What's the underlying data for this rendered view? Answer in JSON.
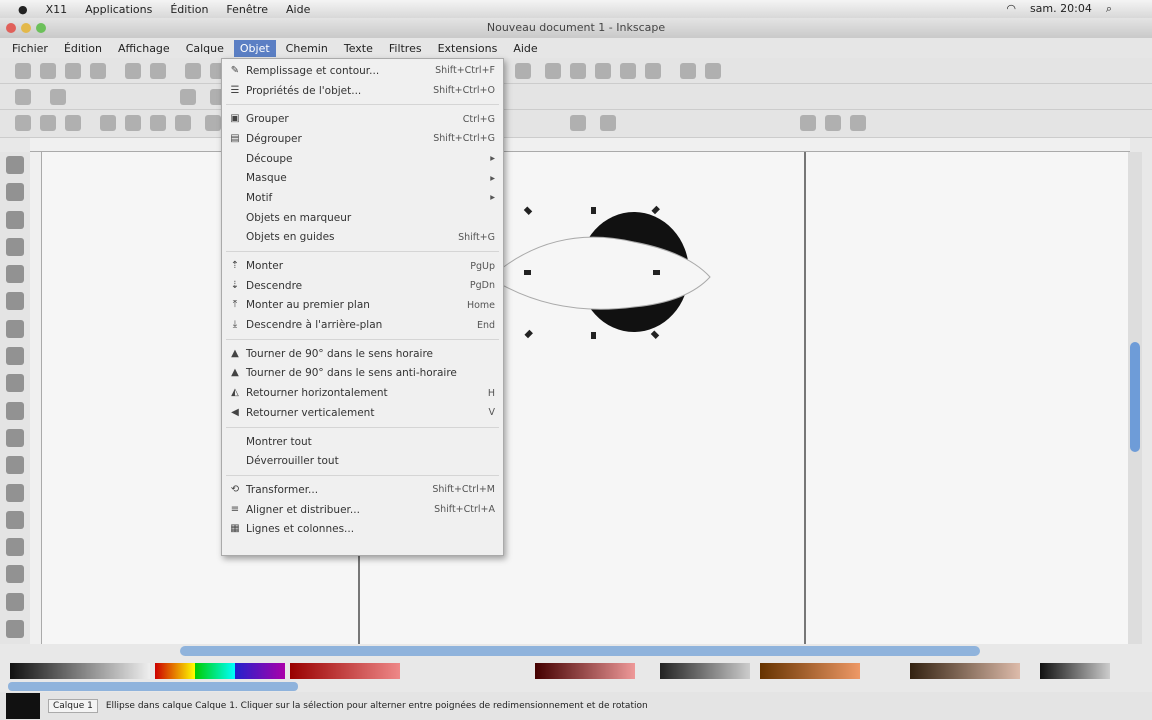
{
  "mac_menubar": {
    "items": [
      "X11",
      "Applications",
      "Édition",
      "Fenêtre",
      "Aide"
    ],
    "clock": "sam. 20:04"
  },
  "window": {
    "title": "Nouveau document 1 - Inkscape"
  },
  "menubar": {
    "items": [
      "Fichier",
      "Édition",
      "Affichage",
      "Calque",
      "Objet",
      "Chemin",
      "Texte",
      "Filtres",
      "Extensions",
      "Aide"
    ],
    "active_index": 4
  },
  "object_menu": {
    "groups": [
      [
        {
          "label": "Remplissage et contour...",
          "shortcut": "Shift+Ctrl+F",
          "icon": "✎"
        },
        {
          "label": "Propriétés de l'objet...",
          "shortcut": "Shift+Ctrl+O",
          "icon": "☰"
        }
      ],
      [
        {
          "label": "Grouper",
          "shortcut": "Ctrl+G",
          "icon": "▣"
        },
        {
          "label": "Dégrouper",
          "shortcut": "Shift+Ctrl+G",
          "icon": "▤"
        },
        {
          "label": "Découpe",
          "shortcut": "▸",
          "icon": ""
        },
        {
          "label": "Masque",
          "shortcut": "▸",
          "icon": ""
        },
        {
          "label": "Motif",
          "shortcut": "▸",
          "icon": ""
        },
        {
          "label": "Objets en marqueur",
          "shortcut": "",
          "icon": ""
        },
        {
          "label": "Objets en guides",
          "shortcut": "Shift+G",
          "icon": ""
        }
      ],
      [
        {
          "label": "Monter",
          "shortcut": "PgUp",
          "icon": "⇡"
        },
        {
          "label": "Descendre",
          "shortcut": "PgDn",
          "icon": "⇣"
        },
        {
          "label": "Monter au premier plan",
          "shortcut": "Home",
          "icon": "⤒"
        },
        {
          "label": "Descendre à l'arrière-plan",
          "shortcut": "End",
          "icon": "⤓"
        }
      ],
      [
        {
          "label": "Tourner de 90° dans le sens horaire",
          "shortcut": "",
          "icon": "▲"
        },
        {
          "label": "Tourner de 90° dans le sens anti-horaire",
          "shortcut": "",
          "icon": "▲"
        },
        {
          "label": "Retourner horizontalement",
          "shortcut": "H",
          "icon": "◭"
        },
        {
          "label": "Retourner verticalement",
          "shortcut": "V",
          "icon": "◀"
        }
      ],
      [
        {
          "label": "Montrer tout",
          "shortcut": "",
          "icon": ""
        },
        {
          "label": "Déverrouiller tout",
          "shortcut": "",
          "icon": ""
        }
      ],
      [
        {
          "label": "Transformer...",
          "shortcut": "Shift+Ctrl+M",
          "icon": "⟲"
        },
        {
          "label": "Aligner et distribuer...",
          "shortcut": "Shift+Ctrl+A",
          "icon": "≡"
        },
        {
          "label": "Lignes et colonnes...",
          "shortcut": "",
          "icon": "▦"
        }
      ]
    ]
  },
  "status": {
    "layer": "Calque 1",
    "message": "Ellipse dans calque Calque 1. Cliquer sur la sélection pour alterner entre poignées de redimensionnement et de rotation"
  },
  "colors": {
    "menu_highlight": "#5b7fc4",
    "scroll": "#8fb3dc"
  }
}
